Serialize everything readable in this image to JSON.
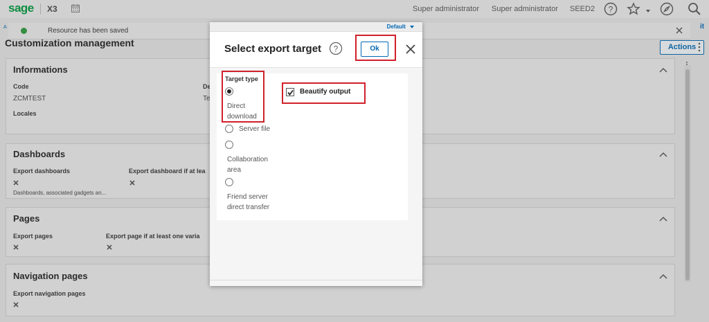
{
  "topbar": {
    "logo": "sage",
    "product": "X3",
    "user1": "Super administrator",
    "user2": "Super administrator",
    "folder": "SEED2",
    "icons": [
      "calendar-icon",
      "help-icon",
      "star-icon",
      "compass-icon",
      "search-icon"
    ]
  },
  "notification": {
    "message": "Resource has been saved"
  },
  "page": {
    "title": "Customization management",
    "actions_label": "Actions"
  },
  "sections": {
    "informations": {
      "title": "Informations",
      "code_label": "Code",
      "code_value": "ZCMTEST",
      "desc_label": "De",
      "desc_value": "Te",
      "locales_label": "Locales"
    },
    "dashboards": {
      "title": "Dashboards",
      "export_label": "Export dashboards",
      "export_if_label": "Export dashboard if at lea",
      "note": "Dashboards, associated gadgets an..."
    },
    "pages": {
      "title": "Pages",
      "export_label": "Export pages",
      "export_if_label": "Export page if at least one varia"
    },
    "navigation": {
      "title": "Navigation pages",
      "export_label": "Export navigation pages"
    }
  },
  "dialog": {
    "default_tag": "Default",
    "title": "Select export target",
    "ok_label": "Ok",
    "target_type_label": "Target type",
    "options": [
      {
        "line1": "Direct",
        "line2": "download",
        "selected": true
      },
      {
        "line1": "Server file",
        "line2": "",
        "selected": false
      },
      {
        "line1": "Collaboration",
        "line2": "area",
        "selected": false
      },
      {
        "line1": "Friend server",
        "line2": "direct transfer",
        "selected": false
      }
    ],
    "beautify_label": "Beautify output",
    "beautify_checked": true
  },
  "colors": {
    "brand": "#009a3d",
    "accent": "#0067b3",
    "highlight": "#d0202a"
  }
}
